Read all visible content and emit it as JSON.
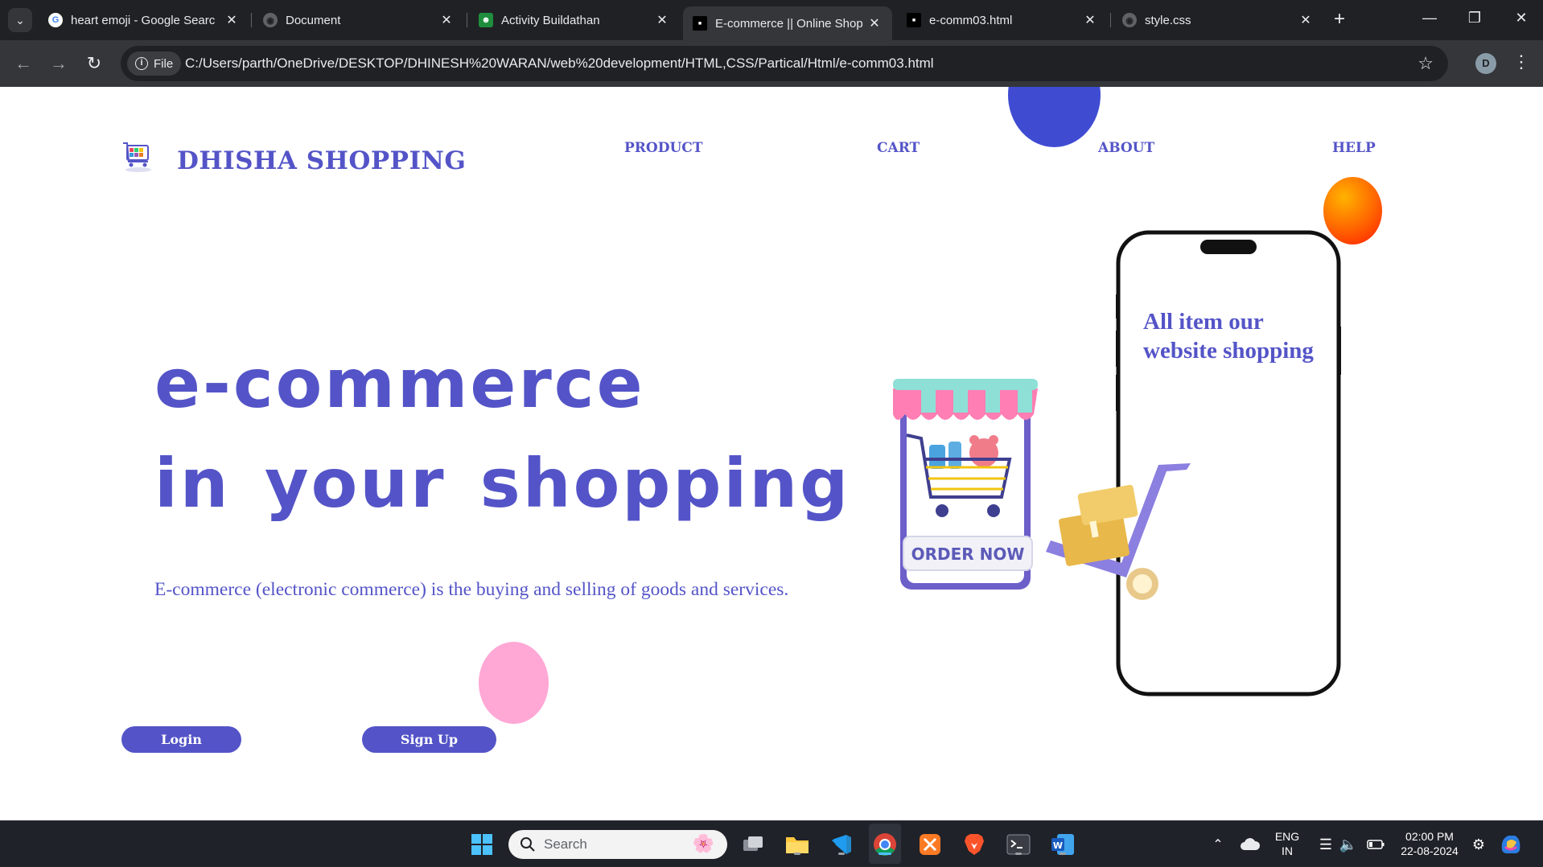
{
  "browser": {
    "tabs": [
      {
        "title": "heart emoji - Google Searc",
        "active": false,
        "icon": "google-icon"
      },
      {
        "title": "Document",
        "active": false,
        "icon": "globe-icon"
      },
      {
        "title": "Activity Buildathan",
        "active": false,
        "icon": "classroom-icon"
      },
      {
        "title": "E-commerce || Online Shop",
        "active": true,
        "icon": "page-thumb-icon"
      },
      {
        "title": "e-comm03.html",
        "active": false,
        "icon": "page-thumb-icon"
      },
      {
        "title": "style.css",
        "active": false,
        "icon": "globe-icon"
      }
    ],
    "address": {
      "chip_label": "File",
      "url": "C:/Users/parth/OneDrive/DESKTOP/DHINESH%20WARAN/web%20development/HTML,CSS/Partical/Html/e-comm03.html"
    },
    "profile_initial": "D"
  },
  "page": {
    "brand": "DHISHA SHOPPING",
    "nav": [
      "PRODUCT",
      "CART",
      "ABOUT",
      "HELP"
    ],
    "hero": {
      "line1": "e-commerce",
      "line2": "in your shopping",
      "description": "E-commerce (electronic commerce) is the buying and selling of goods and services."
    },
    "buttons": {
      "login": "Login",
      "signup": "Sign Up"
    },
    "phone_text": "All item our website shopping",
    "store_badge": "ORDER NOW",
    "colors": {
      "accent": "#5454c8",
      "blue_circle": "#3f4cd2",
      "pink_circle": "#ffa8d6",
      "orange_circle": "#ff6a00"
    }
  },
  "taskbar": {
    "search_placeholder": "Search",
    "lang_top": "ENG",
    "lang_bottom": "IN",
    "time": "02:00 PM",
    "date": "22-08-2024"
  }
}
